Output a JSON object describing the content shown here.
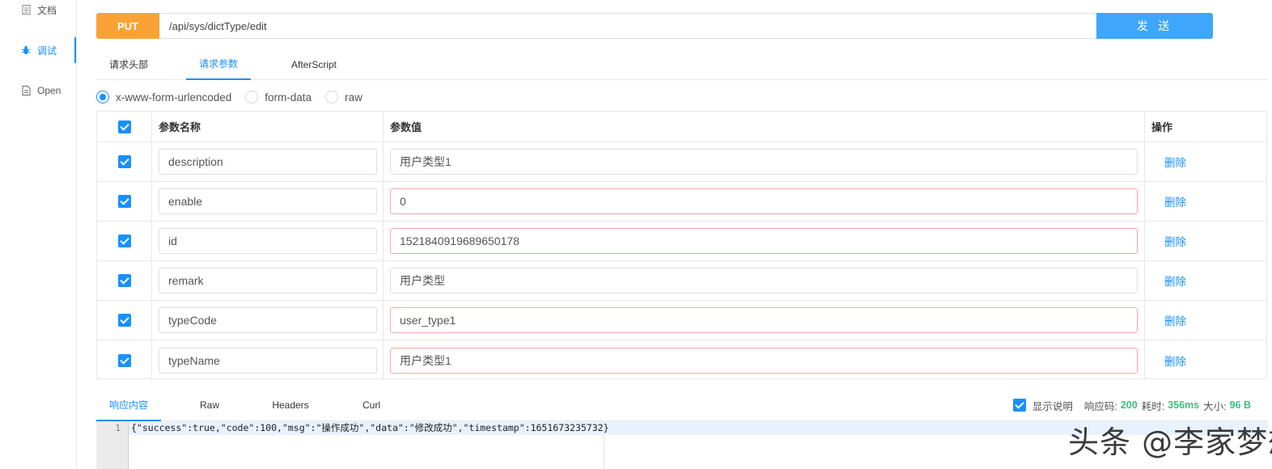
{
  "sidebar": {
    "items": [
      {
        "label": "文档",
        "icon": "document-icon"
      },
      {
        "label": "调试",
        "icon": "bug-icon",
        "active": true
      },
      {
        "label": "Open",
        "icon": "file-icon"
      }
    ]
  },
  "request": {
    "method": "PUT",
    "url": "/api/sys/dictType/edit",
    "send_label": "发 送"
  },
  "tabs": [
    {
      "label": "请求头部"
    },
    {
      "label": "请求参数",
      "active": true
    },
    {
      "label": "AfterScript"
    }
  ],
  "body_types": [
    {
      "label": "x-www-form-urlencoded",
      "checked": true
    },
    {
      "label": "form-data",
      "checked": false
    },
    {
      "label": "raw",
      "checked": false
    }
  ],
  "params_table": {
    "headers": {
      "name": "参数名称",
      "value": "参数值",
      "op": "操作"
    },
    "delete_label": "删除",
    "rows": [
      {
        "name": "description",
        "value": "用户类型1",
        "checked": true
      },
      {
        "name": "enable",
        "value": "0",
        "checked": true
      },
      {
        "name": "id",
        "value": "1521840919689650178",
        "checked": true
      },
      {
        "name": "remark",
        "value": "用户类型",
        "checked": true
      },
      {
        "name": "typeCode",
        "value": "user_type1",
        "checked": true
      },
      {
        "name": "typeName",
        "value": "用户类型1",
        "checked": true
      }
    ]
  },
  "response": {
    "tabs": [
      {
        "label": "响应内容",
        "active": true
      },
      {
        "label": "Raw"
      },
      {
        "label": "Headers"
      },
      {
        "label": "Curl"
      }
    ],
    "show_desc_label": "显示说明",
    "code_label": "响应码:",
    "code": "200",
    "time_label": "耗时:",
    "time": "356ms",
    "size_label": "大小:",
    "size": "96 B",
    "line_number": "1",
    "body": "{\"success\":true,\"code\":100,\"msg\":\"操作成功\",\"data\":\"修改成功\",\"timestamp\":1651673235732}"
  },
  "watermark": "头条 @李家梦想家",
  "colors": {
    "accent": "#1890ff",
    "method_put": "#f9a336",
    "send_button": "#3ea6fb",
    "success_green": "#3bc07f"
  }
}
